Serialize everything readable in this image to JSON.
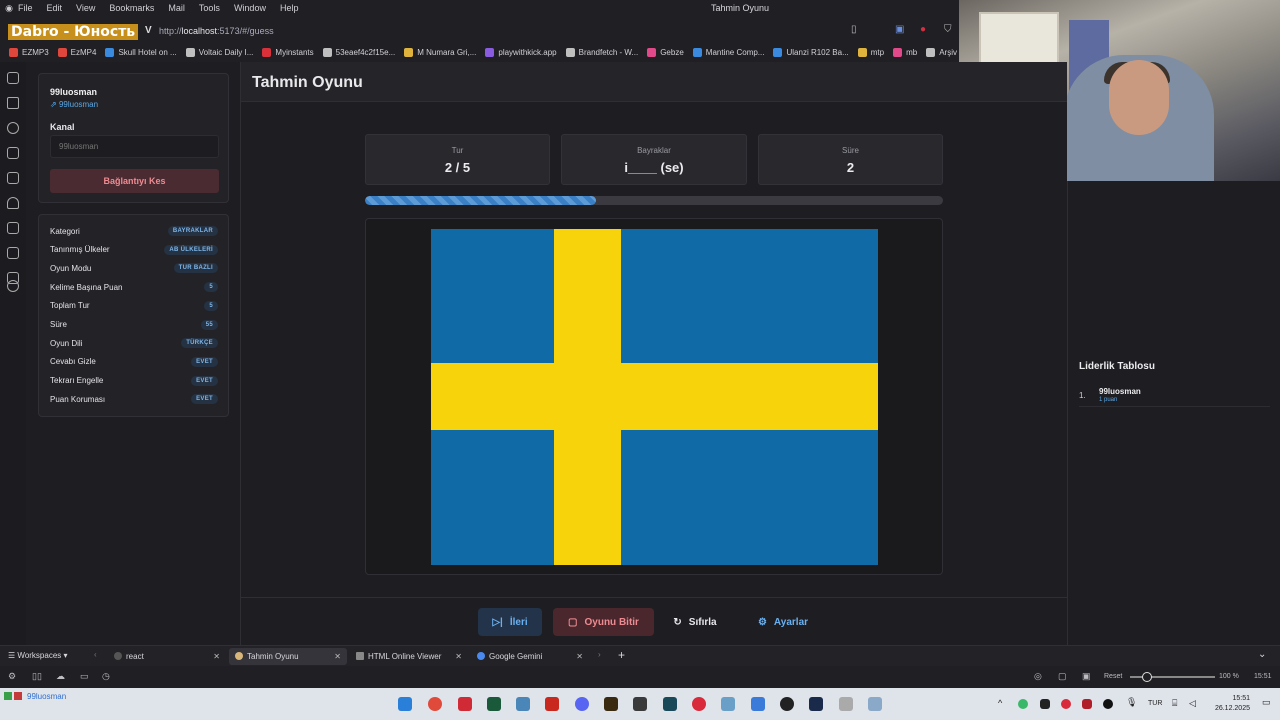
{
  "browser": {
    "menu": [
      "File",
      "Edit",
      "View",
      "Bookmarks",
      "Mail",
      "Tools",
      "Window",
      "Help"
    ],
    "window_title": "Tahmin Oyunu",
    "overlay_title": "Dabro - Юность",
    "url_prefix": "http://",
    "url_host": "localhost",
    "url_rest": ":5173/#/guess",
    "bookmarks": [
      "EZMP3",
      "EzMP4",
      "Skull Hotel on ...",
      "Voltaic Daily I...",
      "Myinstants",
      "53eaef4c2f15e...",
      "M Numara Gri,...",
      "playwithkick.app",
      "Brandfetch - W...",
      "Gebze",
      "Mantine Comp...",
      "Ulanzi R102 Ba...",
      "mtp",
      "mb",
      "Arşiv"
    ],
    "bookmark_colors": [
      "#e0473c",
      "#e0473c",
      "#3a8be0",
      "#bfbfbf",
      "#d9303a",
      "#bfbfbf",
      "#e0b43c",
      "#8a5ce0",
      "#bfbfbf",
      "#e04a8a",
      "#3a8be0",
      "#3a8be0",
      "#e0b43c",
      "#e04a8a",
      "#bfbfbf"
    ]
  },
  "sidebar": {
    "username": "99luosman",
    "user_link": "99luosman",
    "kanal_label": "Kanal",
    "kanal_placeholder": "99luosman",
    "disconnect_label": "Bağlantıyı Kes",
    "settings": [
      {
        "label": "Kategori",
        "value": "BAYRAKLAR"
      },
      {
        "label": "Tanınmış Ülkeler",
        "value": "AB ÜLKELERİ"
      },
      {
        "label": "Oyun Modu",
        "value": "TUR BAZLI"
      },
      {
        "label": "Kelime Başına Puan",
        "value": "5"
      },
      {
        "label": "Toplam Tur",
        "value": "5"
      },
      {
        "label": "Süre",
        "value": "55"
      },
      {
        "label": "Oyun Dili",
        "value": "TÜRKÇE"
      },
      {
        "label": "Cevabı Gizle",
        "value": "EVET"
      },
      {
        "label": "Tekrarı Engelle",
        "value": "EVET"
      },
      {
        "label": "Puan Koruması",
        "value": "EVET"
      }
    ]
  },
  "main": {
    "title": "Tahmin Oyunu",
    "stats": [
      {
        "label": "Tur",
        "value": "2 / 5"
      },
      {
        "label": "Bayraklar",
        "value": "i____ (se)"
      },
      {
        "label": "Süre",
        "value": "2"
      }
    ],
    "progress_fraction": 0.4,
    "flag": {
      "country_code": "se",
      "blue": "#106aa6",
      "yellow": "#f6d30b"
    },
    "buttons": {
      "next": "İleri",
      "end": "Oyunu Bitir",
      "reset": "Sıfırla",
      "settings": "Ayarlar"
    }
  },
  "leaderboard": {
    "title": "Liderlik Tablosu",
    "entries": [
      {
        "rank": "1.",
        "name": "99luosman",
        "score": "1 puan"
      }
    ]
  },
  "tabs": {
    "workspaces": "Workspaces",
    "items": [
      {
        "label": "react",
        "active": false
      },
      {
        "label": "Tahmin Oyunu",
        "active": true
      },
      {
        "label": "HTML Online Viewer",
        "active": false
      },
      {
        "label": "Google Gemini",
        "active": false
      }
    ]
  },
  "status": {
    "reset": "Reset",
    "zoom": "100 %",
    "time": "15:51",
    "profile": "99luosman"
  },
  "taskbar": {
    "lang": "TUR",
    "time": "15:51",
    "date": "26.12.2025"
  }
}
